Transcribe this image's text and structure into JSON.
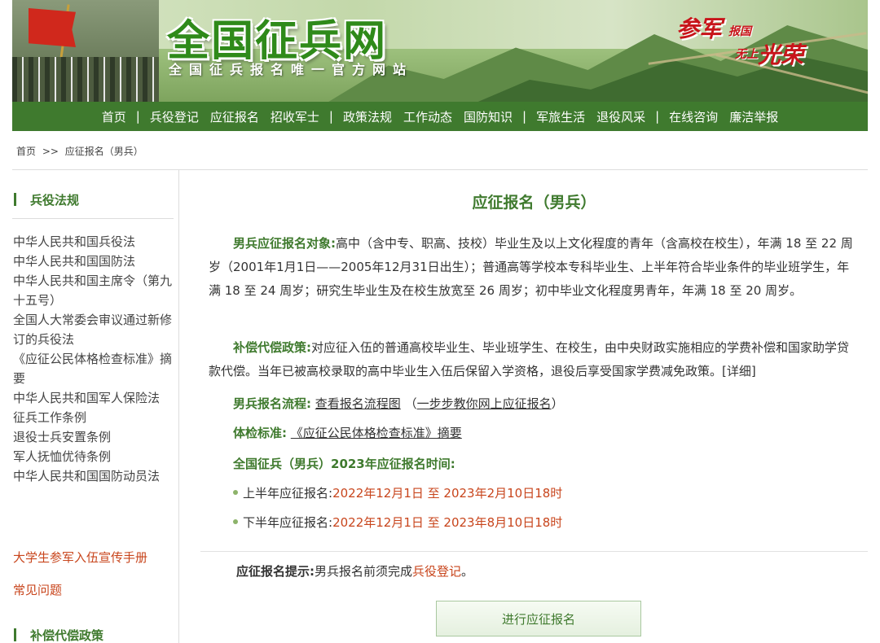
{
  "banner": {
    "title": "全国征兵网",
    "subtitle": "全国征兵报名唯一官方网站",
    "slogan": {
      "a": "参军",
      "b": "报国",
      "c": "无上",
      "d": "光荣"
    }
  },
  "nav": [
    "首页",
    "|",
    "兵役登记",
    "应征报名",
    "招收军士",
    "|",
    "政策法规",
    "工作动态",
    "国防知识",
    "|",
    "军旅生活",
    "退役风采",
    "|",
    "在线咨询",
    "廉洁举报"
  ],
  "breadcrumb": {
    "home": "首页",
    "arrow": ">>",
    "current": "应征报名（男兵）"
  },
  "sidebar": {
    "heading1": "兵役法规",
    "items": [
      "中华人民共和国兵役法",
      "中华人民共和国国防法",
      "中华人民共和国主席令（第九十五号）",
      "全国人大常委会审议通过新修订的兵役法",
      "《应征公民体格检查标准》摘要",
      "中华人民共和国军人保险法",
      "征兵工作条例",
      "退役士兵安置条例",
      "军人抚恤优待条例",
      "中华人民共和国国防动员法"
    ],
    "red_link1": "大学生参军入伍宣传手册",
    "red_link2": "常见问题",
    "heading2": "补偿代偿政策"
  },
  "main": {
    "title": "应征报名（男兵）",
    "p1_label": "男兵应征报名对象:",
    "p1_text": "高中（含中专、职高、技校）毕业生及以上文化程度的青年（含高校在校生），年满 18 至 22 周岁（2001年1月1日——2005年12月31日出生）；普通高等学校本专科毕业生、上半年符合毕业条件的毕业班学生，年满 18 至 24 周岁；研究生毕业生及在校生放宽至 26 周岁；初中毕业文化程度男青年，年满 18 至 20 周岁。",
    "p2_label": "补偿代偿政策:",
    "p2_text": "对应征入伍的普通高校毕业生、毕业班学生、在校生，由中央财政实施相应的学费补偿和国家助学贷款代偿。当年已被高校录取的高中毕业生入伍后保留入学资格，退役后享受国家学费减免政策。",
    "p2_detail": "[详细]",
    "flow_label": "男兵报名流程:",
    "flow_link": "查看报名流程图",
    "flow_paren_open": "（",
    "flow_link2": "一步步教你网上应征报名",
    "flow_paren_close": "）",
    "exam_label": "体检标准:",
    "exam_link": "《应征公民体格检查标准》摘要",
    "time_label": "全国征兵（男兵）2023年应征报名时间:",
    "first_half_label": "上半年应征报名:",
    "first_half_value": "2022年12月1日 至 2023年2月10日18时",
    "second_half_label": "下半年应征报名:",
    "second_half_value": "2022年12月1日 至 2023年8月10日18时",
    "tip_label": "应征报名提示:",
    "tip_text": "男兵报名前须完成",
    "tip_link": "兵役登记",
    "tip_end": "。",
    "button": "进行应征报名"
  },
  "colors": {
    "brand_green": "#3f7a2e",
    "accent_red": "#c8451c"
  }
}
